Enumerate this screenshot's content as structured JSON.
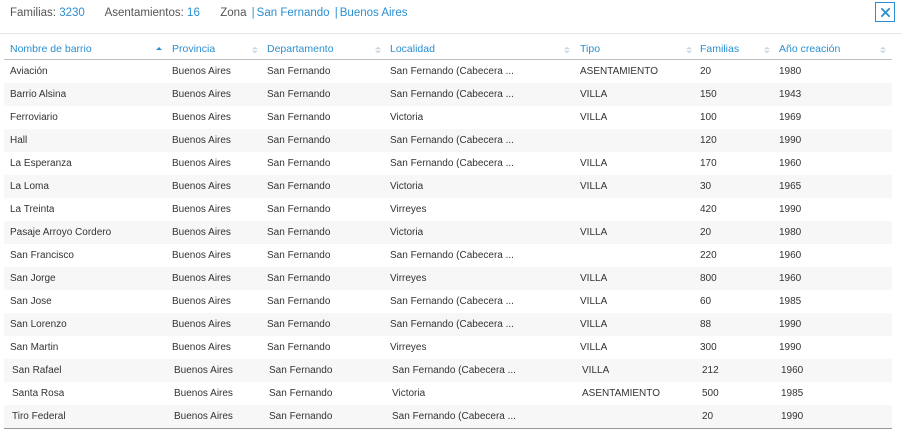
{
  "summary": {
    "familias_label": "Familias:",
    "familias_value": "3230",
    "asentamientos_label": "Asentamientos:",
    "asentamientos_value": "16",
    "zona_label": "Zona",
    "zona_municipio": "San Fernando",
    "zona_provincia": "Buenos Aires"
  },
  "close_label": "close",
  "columns": [
    {
      "key": "barrio",
      "label": "Nombre de barrio",
      "sorted": "asc"
    },
    {
      "key": "provincia",
      "label": "Provincia",
      "sorted": "none"
    },
    {
      "key": "departamento",
      "label": "Departamento",
      "sorted": "none"
    },
    {
      "key": "localidad",
      "label": "Localidad",
      "sorted": "none"
    },
    {
      "key": "tipo",
      "label": "Tipo",
      "sorted": "none"
    },
    {
      "key": "familias",
      "label": "Familias",
      "sorted": "none"
    },
    {
      "key": "anio",
      "label": "Año creación",
      "sorted": "none"
    }
  ],
  "rows": [
    {
      "barrio": "Aviación",
      "provincia": "Buenos Aires",
      "departamento": "San Fernando",
      "localidad": "San Fernando (Cabecera ...",
      "tipo": "ASENTAMIENTO",
      "familias": "20",
      "anio": "1980"
    },
    {
      "barrio": "Barrio Alsina",
      "provincia": "Buenos Aires",
      "departamento": "San Fernando",
      "localidad": "San Fernando (Cabecera ...",
      "tipo": "VILLA",
      "familias": "150",
      "anio": "1943"
    },
    {
      "barrio": "Ferroviario",
      "provincia": "Buenos Aires",
      "departamento": "San Fernando",
      "localidad": "Victoria",
      "tipo": "VILLA",
      "familias": "100",
      "anio": "1969"
    },
    {
      "barrio": "Hall",
      "provincia": "Buenos Aires",
      "departamento": "San Fernando",
      "localidad": "San Fernando (Cabecera ...",
      "tipo": "",
      "familias": "120",
      "anio": "1990"
    },
    {
      "barrio": "La Esperanza",
      "provincia": "Buenos Aires",
      "departamento": "San Fernando",
      "localidad": "San Fernando (Cabecera ...",
      "tipo": "VILLA",
      "familias": "170",
      "anio": "1960"
    },
    {
      "barrio": "La Loma",
      "provincia": "Buenos Aires",
      "departamento": "San Fernando",
      "localidad": "Victoria",
      "tipo": "VILLA",
      "familias": "30",
      "anio": "1965"
    },
    {
      "barrio": "La Treinta",
      "provincia": "Buenos Aires",
      "departamento": "San Fernando",
      "localidad": "Virreyes",
      "tipo": "",
      "familias": "420",
      "anio": "1990"
    },
    {
      "barrio": "Pasaje Arroyo Cordero",
      "provincia": "Buenos Aires",
      "departamento": "San Fernando",
      "localidad": "Victoria",
      "tipo": "VILLA",
      "familias": "20",
      "anio": "1980"
    },
    {
      "barrio": "San Francisco",
      "provincia": "Buenos Aires",
      "departamento": "San Fernando",
      "localidad": "San Fernando (Cabecera ...",
      "tipo": "",
      "familias": "220",
      "anio": "1960"
    },
    {
      "barrio": "San Jorge",
      "provincia": "Buenos Aires",
      "departamento": "San Fernando",
      "localidad": "Virreyes",
      "tipo": "VILLA",
      "familias": "800",
      "anio": "1960"
    },
    {
      "barrio": "San Jose",
      "provincia": "Buenos Aires",
      "departamento": "San Fernando",
      "localidad": "San Fernando (Cabecera ...",
      "tipo": "VILLA",
      "familias": "60",
      "anio": "1985"
    },
    {
      "barrio": "San Lorenzo",
      "provincia": "Buenos Aires",
      "departamento": "San Fernando",
      "localidad": "San Fernando (Cabecera ...",
      "tipo": "VILLA",
      "familias": "88",
      "anio": "1990"
    },
    {
      "barrio": "San Martin",
      "provincia": "Buenos Aires",
      "departamento": "San Fernando",
      "localidad": "Virreyes",
      "tipo": "VILLA",
      "familias": "300",
      "anio": "1990"
    },
    {
      "barrio": "San Rafael",
      "provincia": "Buenos Aires",
      "departamento": "San Fernando",
      "localidad": "San Fernando (Cabecera ...",
      "tipo": "VILLA",
      "familias": "212",
      "anio": "1960"
    },
    {
      "barrio": "Santa Rosa",
      "provincia": "Buenos Aires",
      "departamento": "San Fernando",
      "localidad": "Victoria",
      "tipo": "ASENTAMIENTO",
      "familias": "500",
      "anio": "1985"
    },
    {
      "barrio": "Tiro Federal",
      "provincia": "Buenos Aires",
      "departamento": "San Fernando",
      "localidad": "San Fernando (Cabecera ...",
      "tipo": "",
      "familias": "20",
      "anio": "1990"
    }
  ],
  "colors": {
    "accent": "#2a8fd0",
    "row_alt": "#f7f7f7",
    "text": "#333333"
  }
}
